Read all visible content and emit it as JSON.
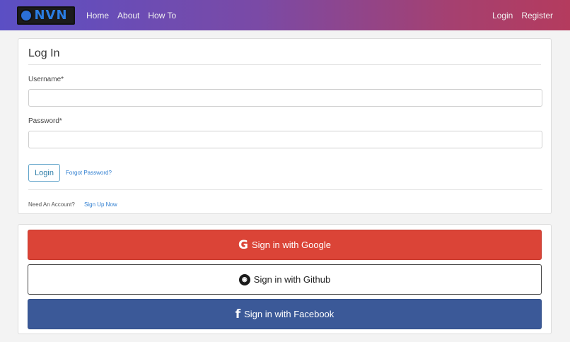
{
  "nav": {
    "logo_text": "NVN",
    "links": [
      {
        "label": "Home"
      },
      {
        "label": "About"
      },
      {
        "label": "How To"
      }
    ],
    "right_links": [
      {
        "label": "Login"
      },
      {
        "label": "Register"
      }
    ]
  },
  "login": {
    "title": "Log In",
    "username_label": "Username*",
    "username_value": "",
    "password_label": "Password*",
    "password_value": "",
    "login_button": "Login",
    "forgot_link": "Forgot Password?",
    "need_account": "Need An Account?",
    "signup_link": "Sign Up Now"
  },
  "social": {
    "google_label": "Sign in with Google",
    "google_icon": "google-icon",
    "github_label": "Sign in with Github",
    "github_icon": "github-icon",
    "facebook_label": "Sign in with Facebook",
    "facebook_icon": "facebook-icon",
    "colors": {
      "google": "#db4437",
      "facebook": "#3b5998",
      "github": "#ffffff"
    }
  }
}
